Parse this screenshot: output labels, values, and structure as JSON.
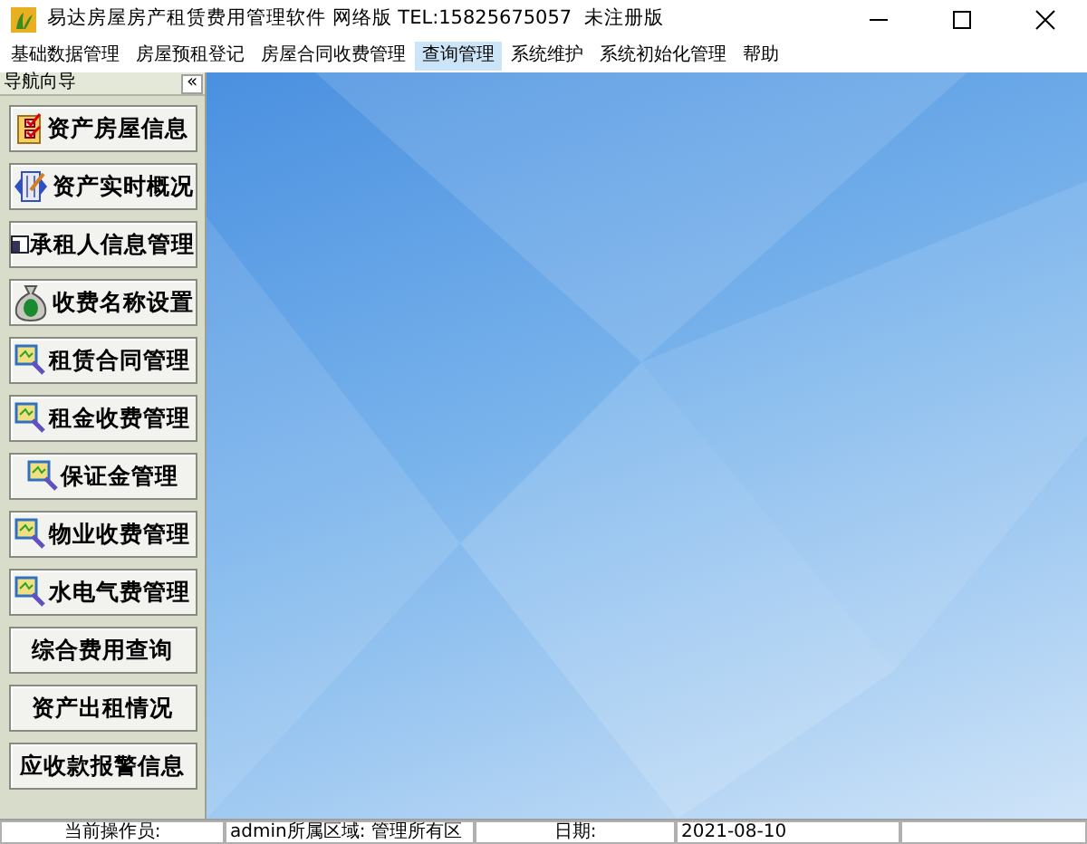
{
  "window": {
    "title": "易达房屋房产租赁费用管理软件 网络版 TEL:15825675057  未注册版"
  },
  "menu": [
    {
      "label": "基础数据管理",
      "selected": false
    },
    {
      "label": "房屋预租登记",
      "selected": false
    },
    {
      "label": "房屋合同收费管理",
      "selected": false
    },
    {
      "label": "查询管理",
      "selected": true
    },
    {
      "label": "系统维护",
      "selected": false
    },
    {
      "label": "系统初始化管理",
      "selected": false
    },
    {
      "label": "帮助",
      "selected": false
    }
  ],
  "sidebar": {
    "title": "导航向导",
    "collapse": "«",
    "items": [
      {
        "label": "资产房屋信息",
        "kind": "checklist"
      },
      {
        "label": "资产实时概况",
        "kind": "book"
      },
      {
        "label": "承租人信息管理",
        "kind": "card"
      },
      {
        "label": "收费名称设置",
        "kind": "moneybag"
      },
      {
        "label": "租赁合同管理",
        "kind": "magnifier"
      },
      {
        "label": "租金收费管理",
        "kind": "magnifier"
      },
      {
        "label": "保证金管理",
        "kind": "magnifier"
      },
      {
        "label": "物业收费管理",
        "kind": "magnifier"
      },
      {
        "label": "水电气费管理",
        "kind": "magnifier"
      },
      {
        "label": "综合费用查询",
        "kind": "plain"
      },
      {
        "label": "资产出租情况",
        "kind": "plain"
      },
      {
        "label": "应收款报警信息",
        "kind": "plain"
      }
    ]
  },
  "status_bar": [
    "当前操作员:",
    "admin所属区域: 管理所有区",
    "日期:",
    "2021-08-10"
  ]
}
